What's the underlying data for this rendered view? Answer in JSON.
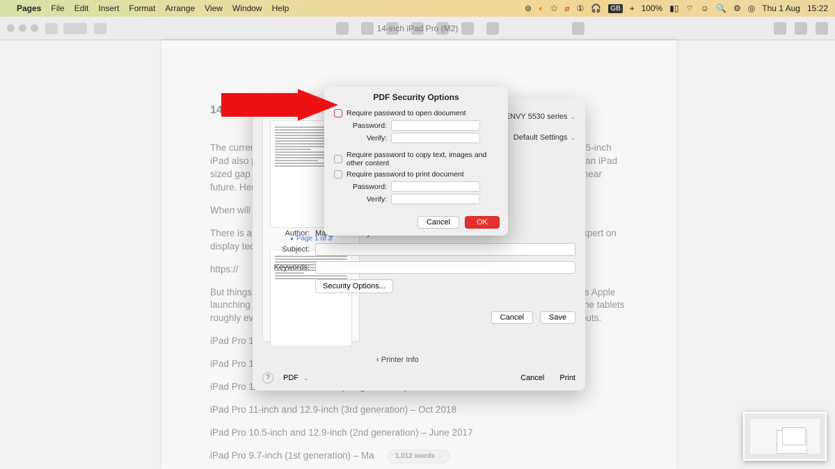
{
  "menubar": {
    "app": "Pages",
    "items": [
      "File",
      "Edit",
      "Insert",
      "Format",
      "Arrange",
      "View",
      "Window",
      "Help"
    ],
    "battery": "100%",
    "lang": "GB",
    "date": "Thu 1 Aug",
    "time": "15:22"
  },
  "window_title": "14-inch iPad Pro (M2)",
  "document": {
    "heading": "14-inch iPad Pro",
    "p1": "The current Pro lineup is comprised of the 11-inch and 12.9-inch models. The standard 10.5-inch iPad also proves a popular choice as it's the most affordable, but if you feel there's a bit of an iPad sized gap in your heart then the rumours of a larger model suggest it could be filled in the near future. Here's everything we know so far about the 14-inch iPad Pro.",
    "p2": "When will the 14-inch iPad Pro be released?",
    "p3": "There is a lot of conflicting information about the larger iPad Pro model. Ross Young, an expert on display technology, stated in June 2022 that there would be a 14.1-inch model in 2023.",
    "p4": "https://",
    "p5": "But things are a little less certain than that. Even though all the rumors are pointing towards Apple launching a 14-inch iPad Pro, we still don't know much about it. Apple has been updating the tablets roughly every eighteen months, although there have been times when they made their debuts.",
    "li1": "iPad Pro 11-inch and 12.9-inch (6th generation) – Oct 2022",
    "li2": "iPad Pro 11-inch and 12.9-inch (5th generation) – Apr 2021",
    "li3": "iPad Pro 11-inch and 12.9-inch (4th generation) - Mar 2020",
    "li4": "iPad Pro 11-inch and 12.9-inch (3rd generation) – Oct 2018",
    "li5": "iPad Pro 10.5-inch and 12.9-inch (2nd generation) – June 2017",
    "li6": "iPad Pro 9.7-inch (1st generation) – Ma"
  },
  "print": {
    "printer": "HP ENVY 5530 series",
    "presets": "Default Settings",
    "page_indicator": "Page 1 of 3",
    "author_label": "Author:",
    "author": "Martyn Casserly",
    "subject_label": "Subject:",
    "keywords_label": "Keywords:",
    "sec_btn": "Security Options...",
    "cancel": "Cancel",
    "save": "Save",
    "printer_info": "Printer Info",
    "pdf": "PDF",
    "print_btn": "Print",
    "cancel2": "Cancel"
  },
  "sec": {
    "title": "PDF Security Options",
    "chk_open": "Require password to open document",
    "chk_copy": "Require password to copy text, images and other content",
    "chk_print": "Require password to print document",
    "password": "Password:",
    "verify": "Verify:",
    "cancel": "Cancel",
    "ok": "OK"
  },
  "wordcount": "1,012 words"
}
